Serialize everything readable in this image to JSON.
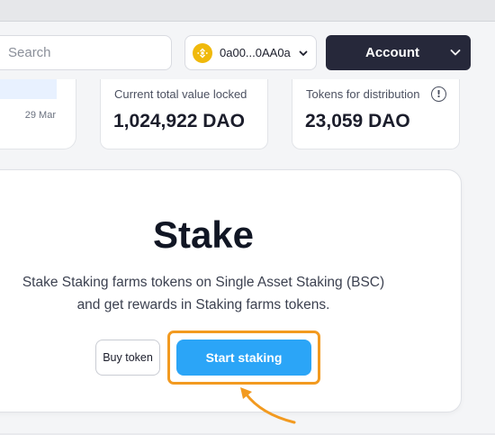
{
  "search": {
    "placeholder": "Search"
  },
  "wallet": {
    "address": "0a00...0AA0a",
    "icon": "bnb-icon"
  },
  "account": {
    "label": "Account"
  },
  "chart": {
    "date_label": "29 Mar"
  },
  "stats": {
    "tvl": {
      "label": "Current total value locked",
      "value": "1,024,922 DAO"
    },
    "distribution": {
      "label": "Tokens for distribution",
      "value": "23,059 DAO",
      "info_icon": "!"
    }
  },
  "stake": {
    "title": "Stake",
    "description": "Stake Staking farms tokens on Single Asset Staking (BSC) and get rewards in Staking farms tokens.",
    "buy_label": "Buy token",
    "start_label": "Start staking"
  },
  "colors": {
    "accent": "#2ba5f7",
    "highlight": "#f29a20",
    "account_bg": "#26283a",
    "bnb": "#f0b90b"
  }
}
